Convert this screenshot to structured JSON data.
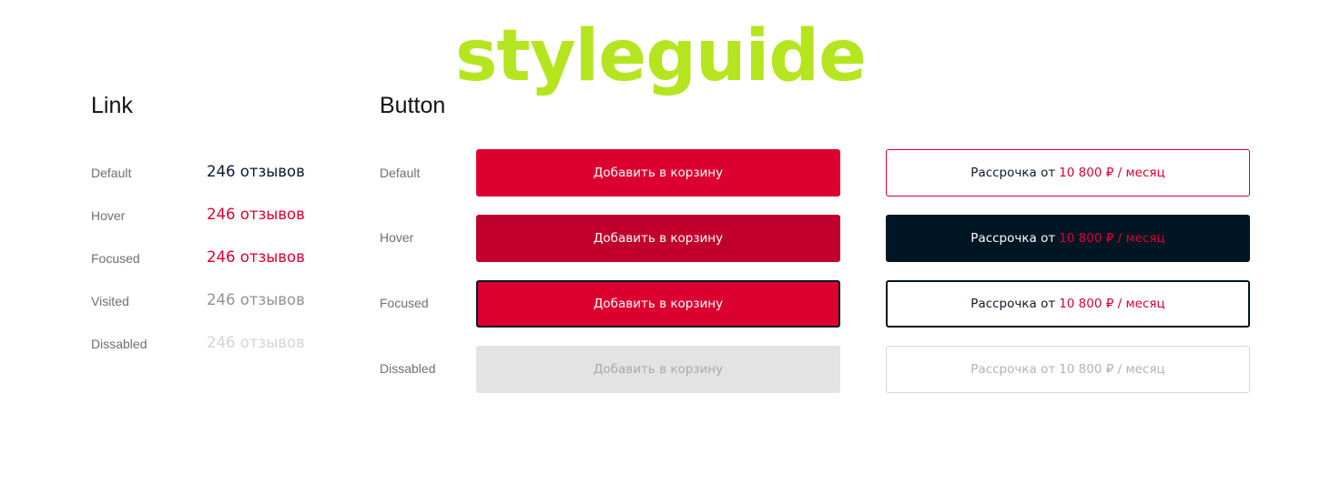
{
  "watermark": "styleguide",
  "colors": {
    "accent": "#dc0030",
    "accent_hover": "#c0002b",
    "dark": "#001624",
    "disabled_bg": "#e4e3e4",
    "disabled_text": "#a9a9a9",
    "watermark": "#b4e51f"
  },
  "link_section": {
    "title": "Link",
    "states": [
      {
        "label": "Default",
        "text": "246 отзывов"
      },
      {
        "label": "Hover",
        "text": "246 отзывов"
      },
      {
        "label": "Focused",
        "text": "246 отзывов"
      },
      {
        "label": "Visited",
        "text": "246 отзывов"
      },
      {
        "label": "Dissabled",
        "text": "246 отзывов"
      }
    ]
  },
  "button_section": {
    "title": "Button",
    "states": [
      "Default",
      "Hover",
      "Focused",
      "Dissabled"
    ],
    "primary_label": "Добавить в корзину",
    "secondary_prefix": "Рассрочка от",
    "secondary_price": "10 800 ₽ / месяц"
  }
}
